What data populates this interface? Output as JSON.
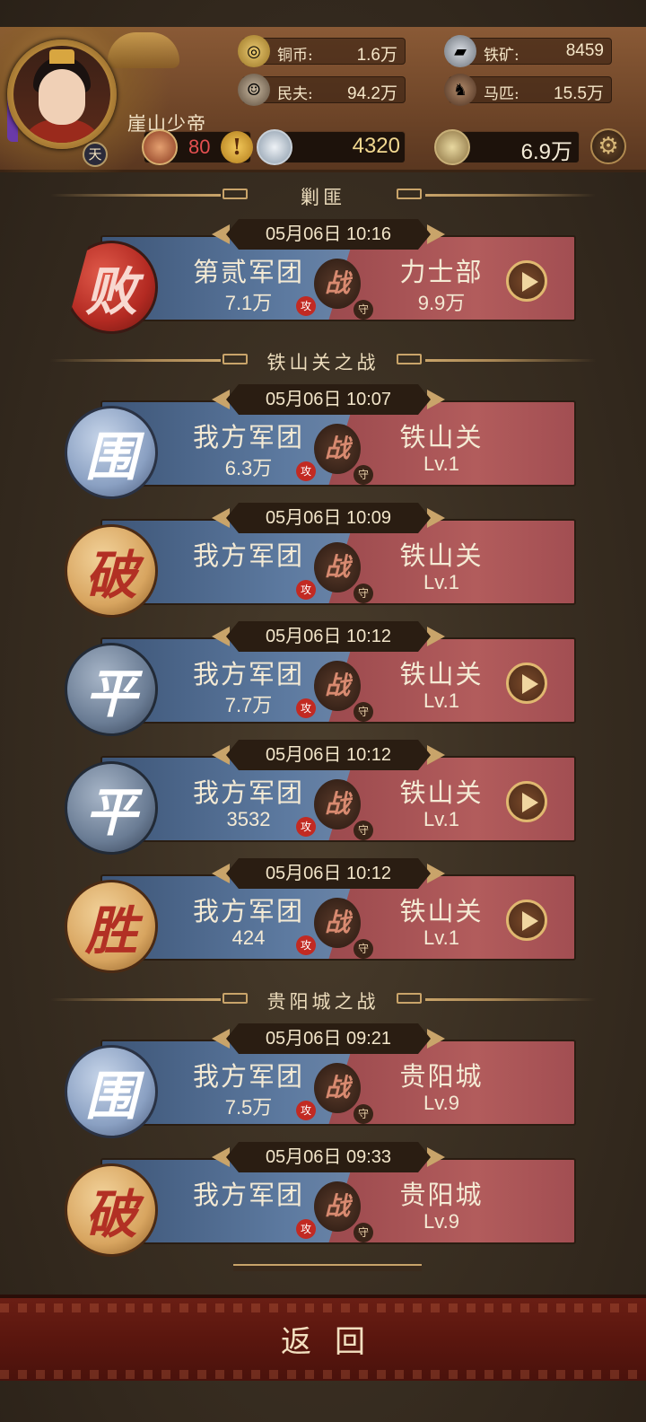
{
  "header": {
    "player_name": "崖山少帝",
    "rank_badge": "天",
    "resources": [
      {
        "label": "铜币:",
        "value": "1.6万",
        "icon": "copper-coin-icon"
      },
      {
        "label": "铁矿:",
        "value": "8459",
        "icon": "iron-ore-icon"
      },
      {
        "label": "民夫:",
        "value": "94.2万",
        "icon": "laborer-icon"
      },
      {
        "label": "马匹:",
        "value": "15.5万",
        "icon": "horse-icon"
      }
    ],
    "stamina": "80",
    "silver": "4320",
    "gold": "6.9万"
  },
  "sections": [
    {
      "title": "剿匪"
    },
    {
      "title": "铁山关之战"
    },
    {
      "title": "贵阳城之战"
    }
  ],
  "battles": [
    {
      "date": "05月06日 10:16",
      "result": "败",
      "medal": "red",
      "attacker": "第贰军团",
      "att_value": "7.1万",
      "defender": "力士部",
      "def_value": "9.9万",
      "replay": true
    },
    {
      "date": "05月06日 10:07",
      "result": "围",
      "medal": "blue",
      "attacker": "我方军团",
      "att_value": "6.3万",
      "defender": "铁山关",
      "def_value": "Lv.1",
      "replay": false
    },
    {
      "date": "05月06日 10:09",
      "result": "破",
      "medal": "gold",
      "attacker": "我方军团",
      "att_value": "",
      "defender": "铁山关",
      "def_value": "Lv.1",
      "replay": false
    },
    {
      "date": "05月06日 10:12",
      "result": "平",
      "medal": "gray",
      "attacker": "我方军团",
      "att_value": "7.7万",
      "defender": "铁山关",
      "def_value": "Lv.1",
      "replay": true
    },
    {
      "date": "05月06日 10:12",
      "result": "平",
      "medal": "gray",
      "attacker": "我方军团",
      "att_value": "3532",
      "defender": "铁山关",
      "def_value": "Lv.1",
      "replay": true
    },
    {
      "date": "05月06日 10:12",
      "result": "胜",
      "medal": "gold",
      "attacker": "我方军团",
      "att_value": "424",
      "defender": "铁山关",
      "def_value": "Lv.1",
      "replay": true
    },
    {
      "date": "05月06日 09:21",
      "result": "围",
      "medal": "blue",
      "attacker": "我方军团",
      "att_value": "7.5万",
      "defender": "贵阳城",
      "def_value": "Lv.9",
      "replay": false
    },
    {
      "date": "05月06日 09:33",
      "result": "破",
      "medal": "gold",
      "attacker": "我方军团",
      "att_value": "",
      "defender": "贵阳城",
      "def_value": "Lv.9",
      "replay": false
    }
  ],
  "labels": {
    "vs": "战",
    "attack_tag": "攻",
    "defend_tag": "守",
    "back": "返回",
    "settings_icon": "gear-icon"
  },
  "colors": {
    "attacker_panel": "#5d7aa0",
    "defender_panel": "#b25c5c",
    "bottom_bar": "#5a160e"
  }
}
